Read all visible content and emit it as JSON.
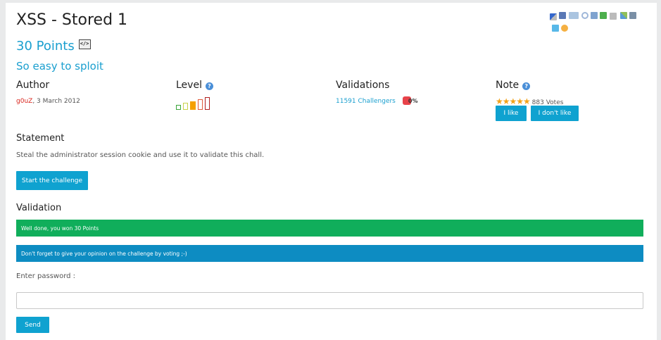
{
  "challenge": {
    "title": "XSS - Stored 1",
    "points": "30 Points",
    "subtitle": "So easy to sploit"
  },
  "author": {
    "header": "Author",
    "name": "g0uZ",
    "date": "3 March 2012"
  },
  "level": {
    "header": "Level",
    "bars": 5,
    "current": 3
  },
  "validations": {
    "header": "Validations",
    "challengers": "11591 Challengers",
    "percent": "0%"
  },
  "note": {
    "header": "Note",
    "stars": 5,
    "votes": "883 Votes",
    "like_label": "I like",
    "dislike_label": "I don't like"
  },
  "statement": {
    "header": "Statement",
    "text": "Steal the administrator session cookie and use it to validate this chall.",
    "start_label": "Start the challenge"
  },
  "validation": {
    "header": "Validation",
    "success_message": "Well done, you won 30 Points",
    "info_message": "Don't forget to give your opinion on the challenge by voting ;-)",
    "password_label": "Enter password :",
    "password_value": "",
    "send_label": "Send"
  },
  "colors": {
    "accent": "#1a9fcf",
    "button": "#0fa2d0",
    "success": "#10ae5b",
    "info": "#0d8cc2",
    "author": "#d9231b"
  },
  "share_icons": [
    "delicious-icon",
    "facebook-icon",
    "digg-icon",
    "google-icon",
    "linkedin-icon",
    "plus-icon",
    "print-icon",
    "scoopit-icon",
    "tumblr-icon",
    "twitter-icon",
    "favorite-icon"
  ]
}
